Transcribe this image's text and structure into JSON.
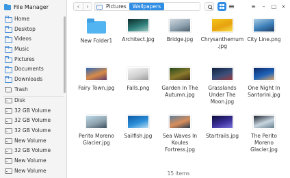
{
  "window": {
    "title": "File Manager"
  },
  "sidebar": {
    "places": [
      {
        "label": "Home",
        "icon": "home-folder-icon"
      },
      {
        "label": "Desktop",
        "icon": "desktop-folder-icon"
      },
      {
        "label": "Videos",
        "icon": "videos-folder-icon"
      },
      {
        "label": "Music",
        "icon": "music-folder-icon"
      },
      {
        "label": "Pictures",
        "icon": "pictures-folder-icon"
      },
      {
        "label": "Documents",
        "icon": "documents-folder-icon"
      },
      {
        "label": "Downloads",
        "icon": "downloads-folder-icon"
      },
      {
        "label": "Trash",
        "icon": "trash-icon"
      }
    ],
    "devices": [
      {
        "label": "Disk",
        "icon": "disk-icon"
      },
      {
        "label": "32 GB Volume",
        "icon": "drive-icon"
      },
      {
        "label": "32 GB Volume",
        "icon": "drive-icon"
      },
      {
        "label": "32 GB Volume",
        "icon": "drive-icon"
      },
      {
        "label": "New Volume",
        "icon": "drive-icon"
      },
      {
        "label": "32 GB Volume",
        "icon": "drive-icon"
      },
      {
        "label": "New Volume",
        "icon": "drive-icon"
      },
      {
        "label": "New Volume",
        "icon": "drive-icon"
      }
    ]
  },
  "toolbar": {
    "back": "‹",
    "forward": "›",
    "breadcrumb": [
      "Pictures",
      "Wallpapers"
    ],
    "search_icon": "search-icon",
    "view_mode": "grid",
    "controls": [
      "≡",
      "–",
      "□",
      "×"
    ]
  },
  "files": [
    {
      "name": "New Folder1",
      "kind": "folder"
    },
    {
      "name": "Architect.jpg",
      "colors": [
        "#0c2b2a",
        "#2f7f7a",
        "#9fc8c2"
      ]
    },
    {
      "name": "Bridge.jpg",
      "colors": [
        "#cfd8de",
        "#8fa2b0",
        "#4d5f6d"
      ]
    },
    {
      "name": "Chrysanthemum.jpg",
      "colors": [
        "#f3c51b",
        "#e7a20f",
        "#f7dd4a"
      ]
    },
    {
      "name": "City Line.png",
      "colors": [
        "#a7cde6",
        "#3d7fb8",
        "#1e3f66"
      ]
    },
    {
      "name": "Fairy Town.jpg",
      "colors": [
        "#2a66b8",
        "#d98b46",
        "#5e3b6c"
      ]
    },
    {
      "name": "Falls.png",
      "colors": [
        "#f4f4f4",
        "#d2d2d2",
        "#9b9b9b"
      ]
    },
    {
      "name": "Garden In The Autumn.jpg",
      "colors": [
        "#274a1c",
        "#8a7a2c",
        "#3c2d16"
      ]
    },
    {
      "name": "Grasslands Under The Moon.jpg",
      "colors": [
        "#0f1f3d",
        "#3a4f7a",
        "#9b3d42"
      ]
    },
    {
      "name": "One Night In Santorini.jpg",
      "colors": [
        "#0c2a6a",
        "#1f62b8",
        "#d9a76c"
      ]
    },
    {
      "name": "Perito Moreno Glacier.jpg",
      "colors": [
        "#bcd9ea",
        "#8fa3ae",
        "#3f5060"
      ]
    },
    {
      "name": "Sailfish.jpg",
      "colors": [
        "#0d5aa8",
        "#2d8fd8",
        "#b9def3"
      ]
    },
    {
      "name": "Sea Waves In Koules Fortress.jpg",
      "colors": [
        "#5d7d9a",
        "#d98d5a",
        "#2a3e52"
      ]
    },
    {
      "name": "Startrails.jpg",
      "colors": [
        "#0b0d3a",
        "#3b2f9a",
        "#7a74d8"
      ]
    },
    {
      "name": "The Perito Moreno Glacier.jpg",
      "colors": [
        "#1d2430",
        "#c8d6e0",
        "#68808f"
      ]
    }
  ],
  "status": {
    "count": "15 items"
  }
}
